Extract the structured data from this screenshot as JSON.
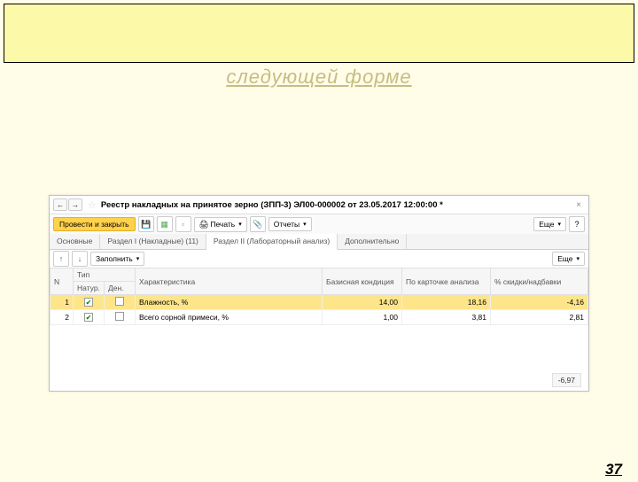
{
  "decor": "следующей форме",
  "title": "Реестр накладных на принятое зерно (ЗПП-3) ЭЛ00-000002 от 23.05.2017 12:00:00 *",
  "toolbar": {
    "post_close": "Провести и закрыть",
    "print": "Печать",
    "reports": "Отчеты",
    "more": "Еще",
    "help": "?"
  },
  "tabs": [
    "Основные",
    "Раздел I (Накладные) (11)",
    "Раздел II (Лабораторный анализ)",
    "Дополнительно"
  ],
  "subtoolbar": {
    "fill": "Заполнить",
    "more": "Еще"
  },
  "cols": {
    "n": "N",
    "type": "Тип",
    "char": "Характеристика",
    "base": "Базисная кондиция",
    "card": "По карточке анализа",
    "disc": "% скидки/надбавки",
    "sub1": "Натур.",
    "sub2": "Ден."
  },
  "rows": [
    {
      "n": "1",
      "natur": true,
      "den": false,
      "char": "Влажность, %",
      "base": "14,00",
      "card": "18,16",
      "disc": "-4,16"
    },
    {
      "n": "2",
      "natur": true,
      "den": false,
      "char": "Всего сорной примеси, %",
      "base": "1,00",
      "card": "3,81",
      "disc": "2,81"
    }
  ],
  "total": "-6,97",
  "page": "37"
}
